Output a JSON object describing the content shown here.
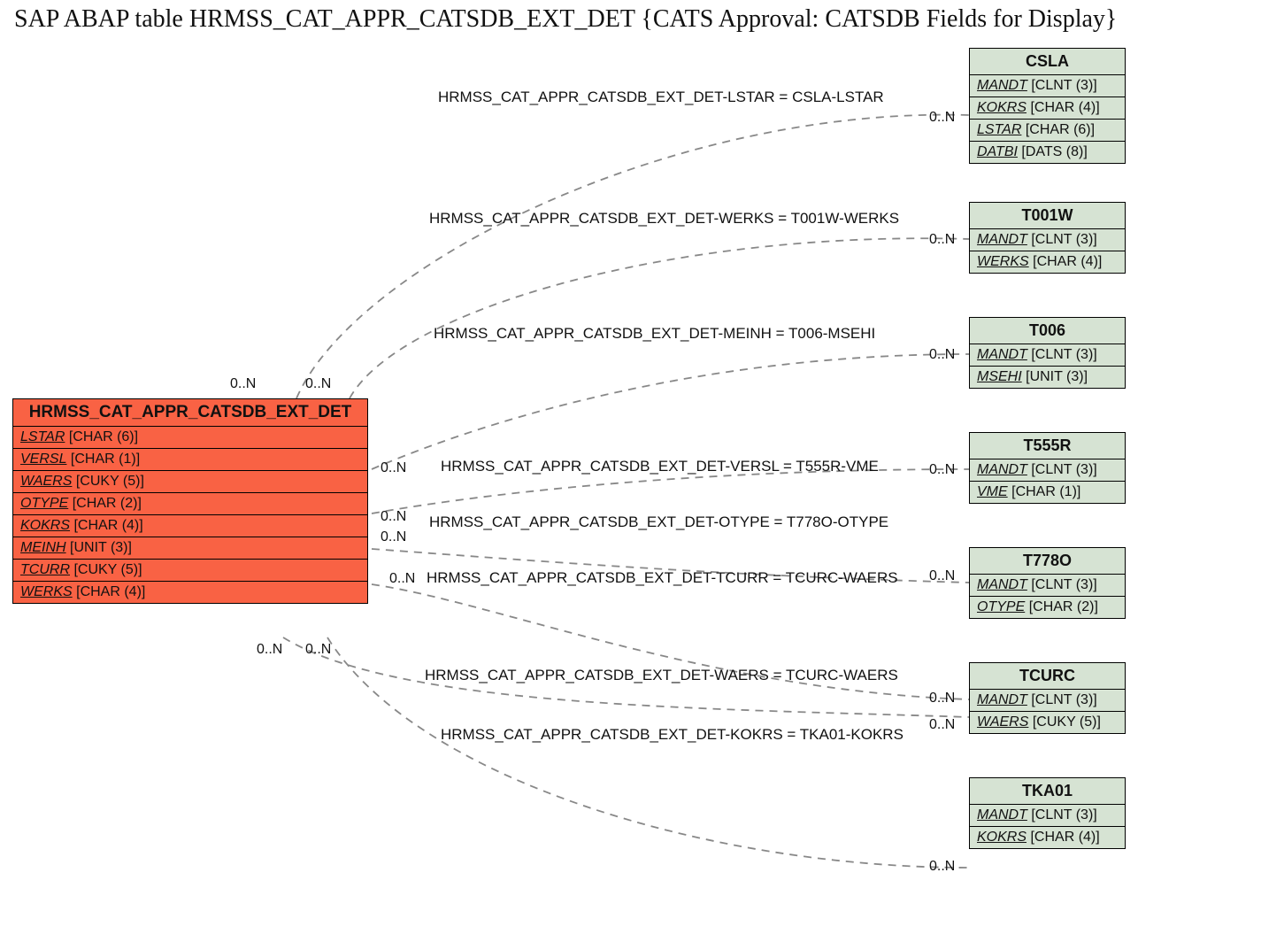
{
  "title": "SAP ABAP table HRMSS_CAT_APPR_CATSDB_EXT_DET {CATS Approval: CATSDB Fields for Display}",
  "main": {
    "name": "HRMSS_CAT_APPR_CATSDB_EXT_DET",
    "rows": [
      {
        "field": "LSTAR",
        "type": "[CHAR (6)]"
      },
      {
        "field": "VERSL",
        "type": "[CHAR (1)]"
      },
      {
        "field": "WAERS",
        "type": "[CUKY (5)]"
      },
      {
        "field": "OTYPE",
        "type": "[CHAR (2)]"
      },
      {
        "field": "KOKRS",
        "type": "[CHAR (4)]"
      },
      {
        "field": "MEINH",
        "type": "[UNIT (3)]"
      },
      {
        "field": "TCURR",
        "type": "[CUKY (5)]"
      },
      {
        "field": "WERKS",
        "type": "[CHAR (4)]"
      }
    ]
  },
  "targets": [
    {
      "name": "CSLA",
      "rows": [
        {
          "field": "MANDT",
          "type": "[CLNT (3)]"
        },
        {
          "field": "KOKRS",
          "type": "[CHAR (4)]"
        },
        {
          "field": "LSTAR",
          "type": "[CHAR (6)]"
        },
        {
          "field": "DATBI",
          "type": "[DATS (8)]"
        }
      ]
    },
    {
      "name": "T001W",
      "rows": [
        {
          "field": "MANDT",
          "type": "[CLNT (3)]"
        },
        {
          "field": "WERKS",
          "type": "[CHAR (4)]"
        }
      ]
    },
    {
      "name": "T006",
      "rows": [
        {
          "field": "MANDT",
          "type": "[CLNT (3)]"
        },
        {
          "field": "MSEHI",
          "type": "[UNIT (3)]"
        }
      ]
    },
    {
      "name": "T555R",
      "rows": [
        {
          "field": "MANDT",
          "type": "[CLNT (3)]"
        },
        {
          "field": "VME",
          "type": "[CHAR (1)]"
        }
      ]
    },
    {
      "name": "T778O",
      "rows": [
        {
          "field": "MANDT",
          "type": "[CLNT (3)]"
        },
        {
          "field": "OTYPE",
          "type": "[CHAR (2)]"
        }
      ]
    },
    {
      "name": "TCURC",
      "rows": [
        {
          "field": "MANDT",
          "type": "[CLNT (3)]"
        },
        {
          "field": "WAERS",
          "type": "[CUKY (5)]"
        }
      ]
    },
    {
      "name": "TKA01",
      "rows": [
        {
          "field": "MANDT",
          "type": "[CLNT (3)]"
        },
        {
          "field": "KOKRS",
          "type": "[CHAR (4)]"
        }
      ]
    }
  ],
  "relations": [
    {
      "label": "HRMSS_CAT_APPR_CATSDB_EXT_DET-LSTAR = CSLA-LSTAR"
    },
    {
      "label": "HRMSS_CAT_APPR_CATSDB_EXT_DET-WERKS = T001W-WERKS"
    },
    {
      "label": "HRMSS_CAT_APPR_CATSDB_EXT_DET-MEINH = T006-MSEHI"
    },
    {
      "label": "HRMSS_CAT_APPR_CATSDB_EXT_DET-VERSL = T555R-VME"
    },
    {
      "label": "HRMSS_CAT_APPR_CATSDB_EXT_DET-OTYPE = T778O-OTYPE"
    },
    {
      "label": "HRMSS_CAT_APPR_CATSDB_EXT_DET-TCURR = TCURC-WAERS"
    },
    {
      "label": "HRMSS_CAT_APPR_CATSDB_EXT_DET-WAERS = TCURC-WAERS"
    },
    {
      "label": "HRMSS_CAT_APPR_CATSDB_EXT_DET-KOKRS = TKA01-KOKRS"
    }
  ],
  "cards": {
    "src": "0..N",
    "tgt": "0..N"
  }
}
